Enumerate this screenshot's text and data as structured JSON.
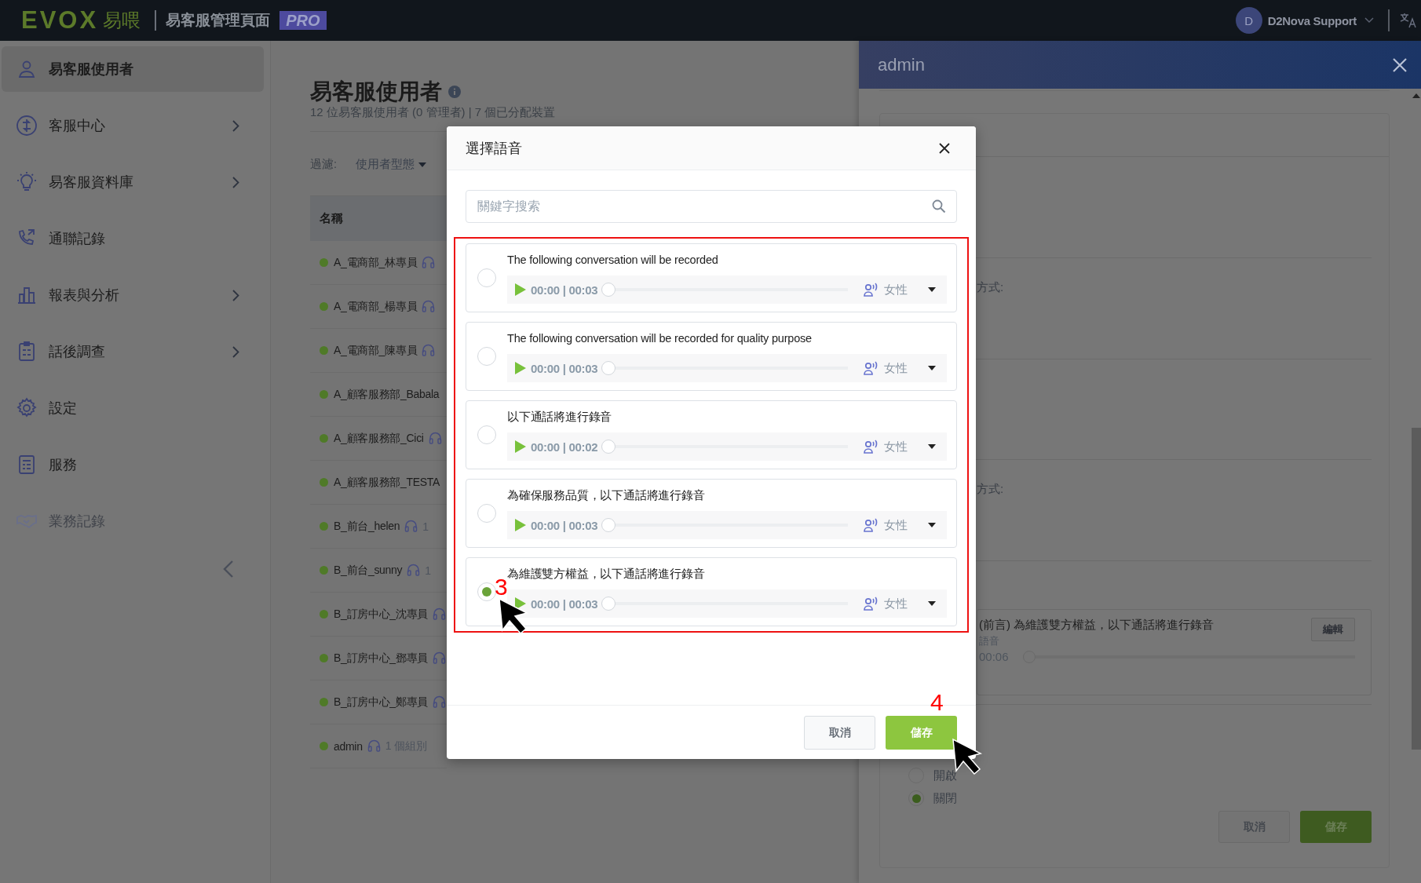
{
  "top_bar": {
    "logo": "EVOX",
    "logo_cn": "易喂",
    "app_title": "易客服管理頁面",
    "badge": "PRO",
    "user_initial": "D",
    "user_name": "D2Nova Support"
  },
  "sidebar": {
    "items": [
      {
        "label": "易客服使用者",
        "selected": true,
        "expandable": false,
        "disabled": false
      },
      {
        "label": "客服中心",
        "selected": false,
        "expandable": true,
        "disabled": false
      },
      {
        "label": "易客服資料庫",
        "selected": false,
        "expandable": true,
        "disabled": false
      },
      {
        "label": "通聯記錄",
        "selected": false,
        "expandable": false,
        "disabled": false
      },
      {
        "label": "報表與分析",
        "selected": false,
        "expandable": true,
        "disabled": false
      },
      {
        "label": "話後調查",
        "selected": false,
        "expandable": true,
        "disabled": false
      },
      {
        "label": "設定",
        "selected": false,
        "expandable": false,
        "disabled": false
      },
      {
        "label": "服務",
        "selected": false,
        "expandable": false,
        "disabled": false
      },
      {
        "label": "業務記錄",
        "selected": false,
        "expandable": false,
        "disabled": true
      }
    ]
  },
  "page": {
    "title": "易客服使用者",
    "subtitle": "12 位易客服使用者 (0 管理者) | 7 個已分配裝置",
    "filter_label": "過濾:",
    "filter_dropdown": "使用者型態",
    "table": {
      "columns": [
        "名稱"
      ],
      "rows": [
        {
          "name": "A_電商部_林專員",
          "headset_icon": true
        },
        {
          "name": "A_電商部_楊專員",
          "headset_icon": true
        },
        {
          "name": "A_電商部_陳專員",
          "headset_icon": true
        },
        {
          "name": "A_顧客服務部_Babala",
          "headset_icon": false
        },
        {
          "name": "A_顧客服務部_Cici",
          "headset_icon": true
        },
        {
          "name": "A_顧客服務部_TESTA",
          "headset_icon": false
        },
        {
          "name": "B_前台_helen",
          "headset_icon": true,
          "count": "1"
        },
        {
          "name": "B_前台_sunny",
          "headset_icon": true,
          "count": "1"
        },
        {
          "name": "B_訂房中心_沈專員",
          "headset_icon": true
        },
        {
          "name": "B_訂房中心_鄧專員",
          "headset_icon": true
        },
        {
          "name": "B_訂房中心_鄭專員",
          "headset_icon": true
        },
        {
          "name": "admin",
          "headset_icon": true,
          "count": "1 個組別"
        }
      ]
    }
  },
  "right_panel": {
    "title": "admin",
    "labels": [
      "方式:",
      "方式:"
    ],
    "greeting": {
      "text": "(前言) 為維護雙方權益，以下通話將進行錄音",
      "sub": "語音",
      "edit": "編輯",
      "time": "00:06",
      "level": 0
    },
    "options": [
      {
        "label": "開啟",
        "selected": false
      },
      {
        "label": "關閉",
        "selected": true
      }
    ],
    "buttons": [
      {
        "label": "取消",
        "kind": "secondary"
      },
      {
        "label": "儲存",
        "kind": "primary"
      }
    ]
  },
  "dialog": {
    "title": "選擇語音",
    "search": {
      "placeholder": "關鍵字搜索"
    },
    "voices": [
      {
        "text": "The following conversation will be recorded",
        "selected": false,
        "time": "00:00 | 00:03",
        "level": 0,
        "voice": "女性"
      },
      {
        "text": "The following conversation will be recorded for quality purpose",
        "selected": false,
        "time": "00:00 | 00:03",
        "level": 0,
        "voice": "女性"
      },
      {
        "text": "以下通話將進行錄音",
        "selected": false,
        "time": "00:00 | 00:02",
        "level": 0,
        "voice": "女性"
      },
      {
        "text": "為確保服務品質，以下通話將進行錄音",
        "selected": false,
        "time": "00:00 | 00:03",
        "level": 0,
        "voice": "女性"
      },
      {
        "text": "為維護雙方權益，以下通話將進行錄音",
        "selected": true,
        "time": "00:00 | 00:03",
        "level": 0,
        "voice": "女性"
      }
    ],
    "buttons": [
      {
        "label": "取消",
        "kind": "secondary"
      },
      {
        "label": "儲存",
        "kind": "primary"
      }
    ]
  },
  "annotations": [
    {
      "label": "3"
    },
    {
      "label": "4"
    }
  ]
}
